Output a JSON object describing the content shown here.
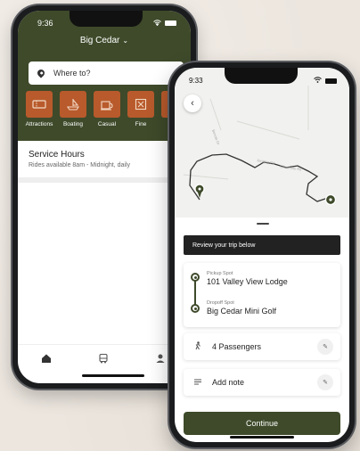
{
  "phone1": {
    "status_time": "9:36",
    "location_title": "Big Cedar",
    "search_placeholder": "Where to?",
    "categories": [
      {
        "label": "Attractions",
        "icon": "ticket-icon"
      },
      {
        "label": "Boating",
        "icon": "boat-icon"
      },
      {
        "label": "Casual",
        "icon": "casual-dining-icon"
      },
      {
        "label": "Fine",
        "icon": "fine-dining-icon"
      }
    ],
    "service_hours": {
      "title": "Service Hours",
      "subtitle": "Rides available 8am - Midnight, daily"
    },
    "tabs": [
      "home-icon",
      "shuttle-icon",
      "profile-icon"
    ]
  },
  "phone2": {
    "status_time": "9:33",
    "review_text": "Review your trip below",
    "pickup": {
      "label": "Pickup Spot",
      "name": "101 Valley View Lodge"
    },
    "dropoff": {
      "label": "Dropoff Spot",
      "name": "Big Cedar Mini Golf"
    },
    "passengers": "4 Passengers",
    "note": "Add note",
    "continue_label": "Continue"
  },
  "colors": {
    "brand_green": "#3e4a2a",
    "category_orange": "#b85a2c",
    "background": "#ece6df"
  }
}
